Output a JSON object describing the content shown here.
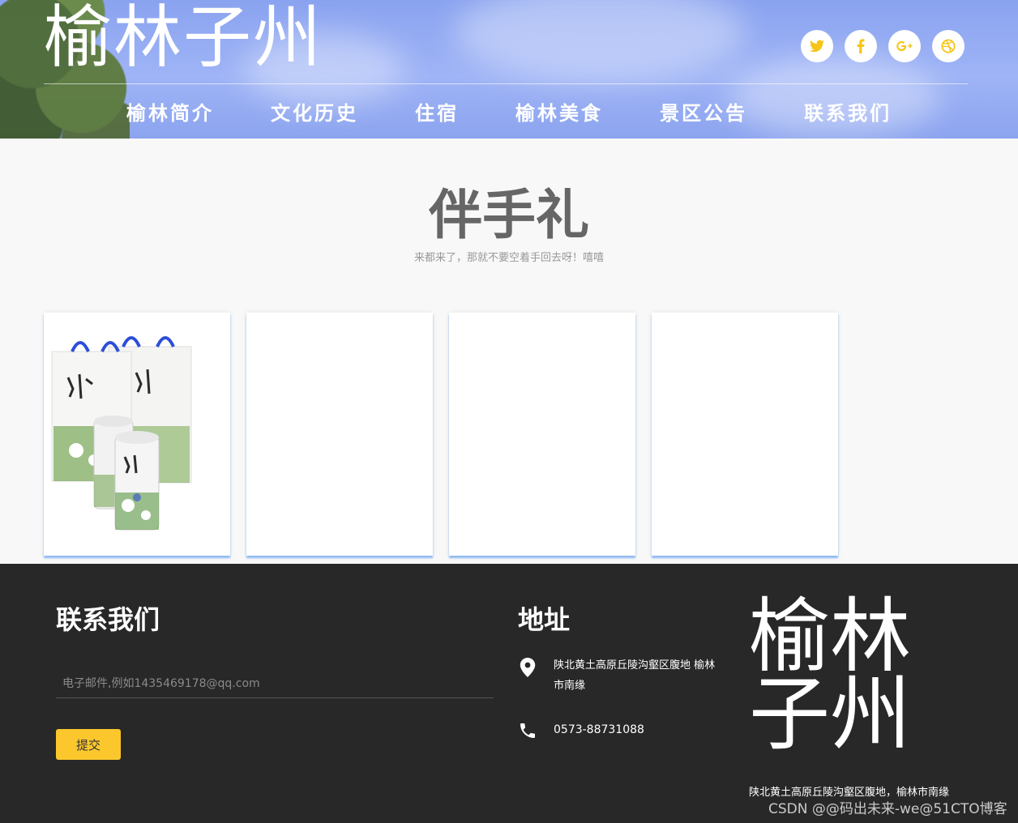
{
  "header": {
    "site_title": "榆林子州",
    "social": [
      {
        "icon": "twitter-icon",
        "glyph": "🐦"
      },
      {
        "icon": "facebook-icon",
        "glyph": "f"
      },
      {
        "icon": "google-plus-icon",
        "glyph": "g+"
      },
      {
        "icon": "dribbble-icon",
        "glyph": "◎"
      }
    ],
    "nav": [
      "榆林简介",
      "文化历史",
      "住宿",
      "榆林美食",
      "景区公告",
      "联系我们"
    ]
  },
  "main": {
    "title": "伴手礼",
    "subtitle": "来都来了，那就不要空着手回去呀！嘻嘻"
  },
  "footer": {
    "contact_title": "联系我们",
    "email_placeholder": "电子邮件,例如1435469178@qq.com",
    "submit_label": "提交",
    "address_title": "地址",
    "address": "陕北黄土高原丘陵沟壑区腹地 榆林市南缘",
    "phone": "0573-88731088",
    "brand": "榆林子州",
    "bottom_text": "陕北黄土高原丘陵沟壑区腹地，榆林市南缘",
    "watermark": "CSDN @@码出未来-we@51CTO博客"
  },
  "colors": {
    "accent": "#fcc72c",
    "footer_bg": "#282828",
    "header_bg": "#8aa3f0"
  }
}
